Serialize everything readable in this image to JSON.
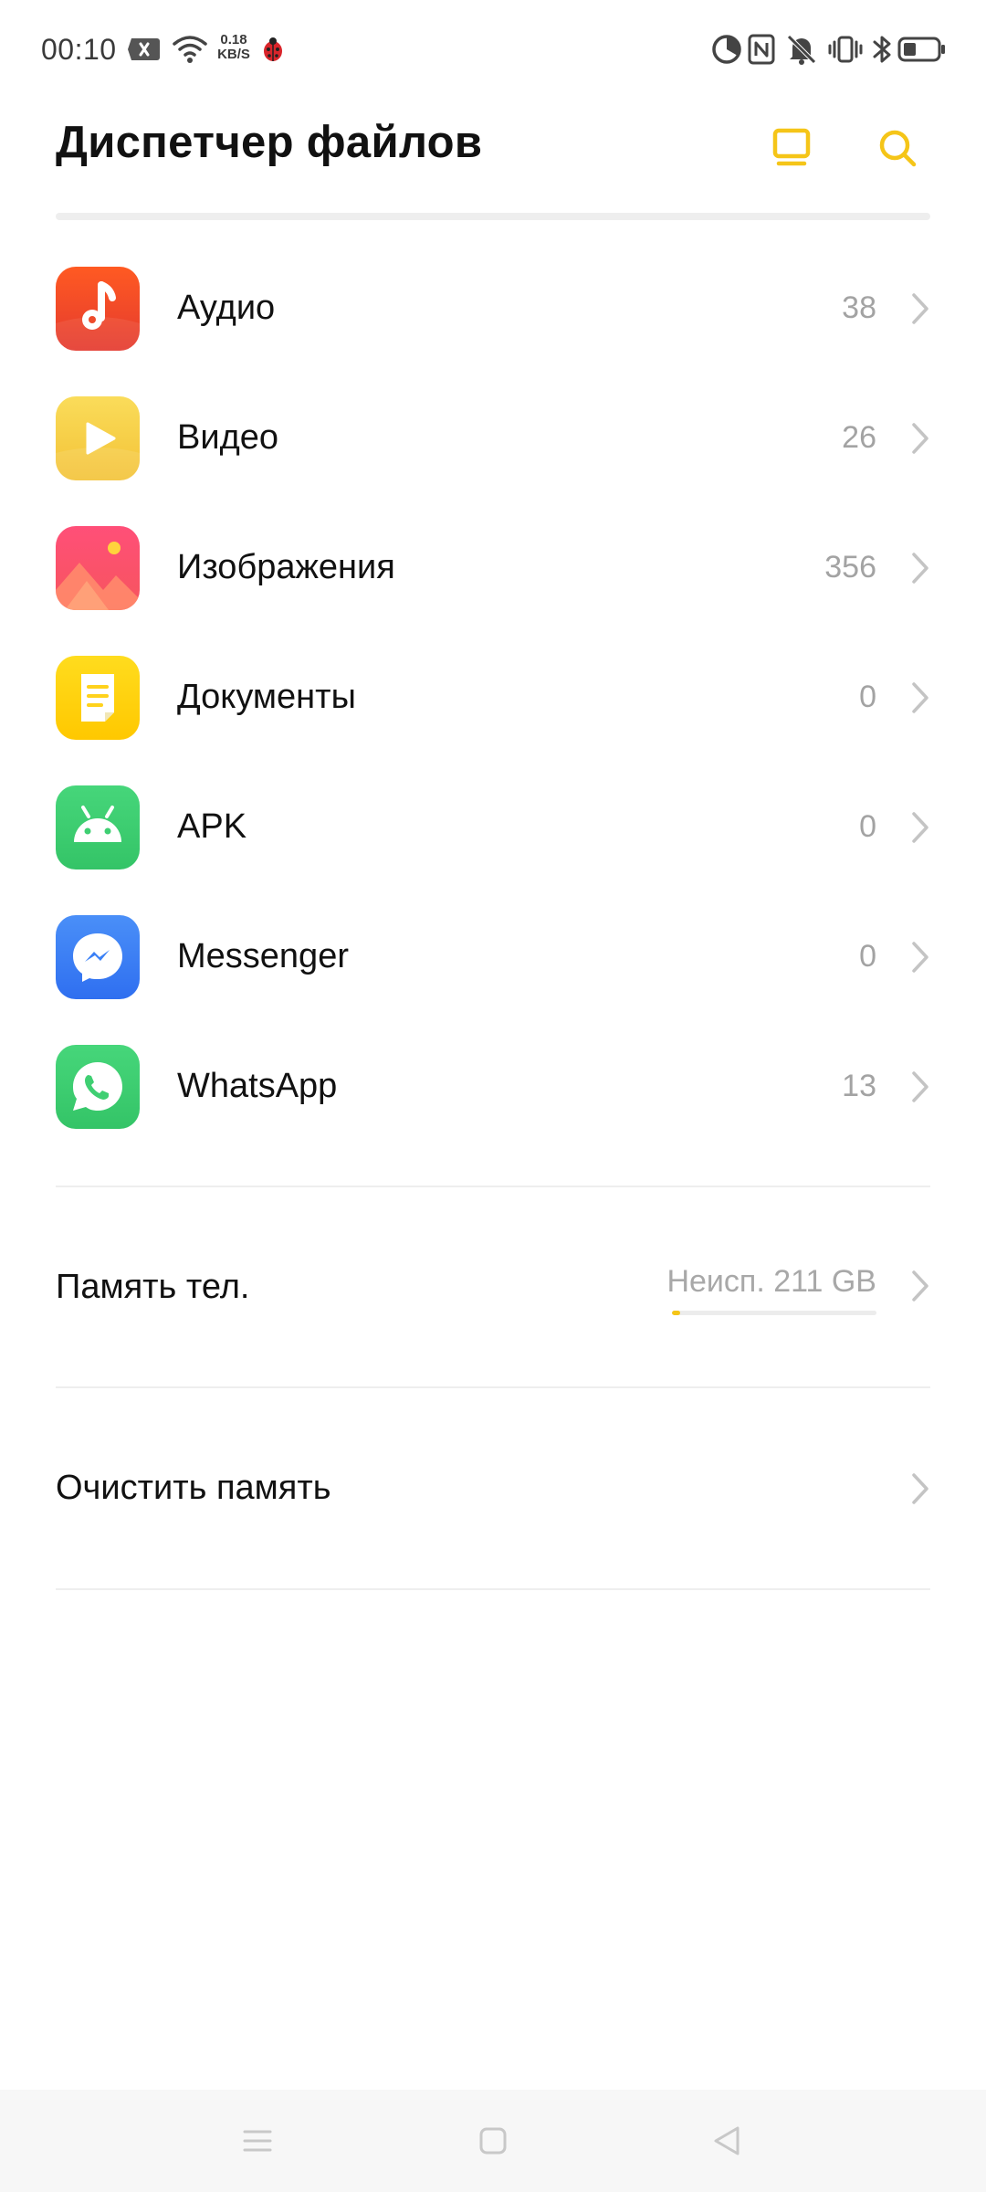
{
  "status_bar": {
    "time": "00:10",
    "net_speed_value": "0.18",
    "net_speed_unit": "KB/S",
    "icons": [
      "notification-x-icon",
      "wifi-icon",
      "ladybug-icon",
      "data-saver-icon",
      "nfc-icon",
      "mute-icon",
      "vibrate-icon",
      "bluetooth-icon",
      "battery-icon"
    ]
  },
  "header": {
    "title": "Диспетчер файлов",
    "icons": [
      "desktop-icon",
      "search-icon"
    ]
  },
  "categories": [
    {
      "label": "Аудио",
      "count": "38",
      "icon": "music-note-icon",
      "color": "#ee4b2b"
    },
    {
      "label": "Видео",
      "count": "26",
      "icon": "play-icon",
      "color": "#f5c842"
    },
    {
      "label": "Изображения",
      "count": "356",
      "icon": "image-icon",
      "color": "#f8506a"
    },
    {
      "label": "Документы",
      "count": "0",
      "icon": "document-icon",
      "color": "#ffd21c"
    },
    {
      "label": "APK",
      "count": "0",
      "icon": "android-icon",
      "color": "#3fcf72"
    },
    {
      "label": "Messenger",
      "count": "0",
      "icon": "messenger-icon",
      "color": "#3a80f6"
    },
    {
      "label": "WhatsApp",
      "count": "13",
      "icon": "whatsapp-icon",
      "color": "#3fcf72"
    }
  ],
  "storage": {
    "label": "Память тел.",
    "free_text": "Неисп. 211 GB",
    "used_fraction": 0.04,
    "bar_color": "#f5c518"
  },
  "clean": {
    "label": "Очистить память"
  },
  "accent_color": "#f5c518",
  "nav_bar": {
    "icons": [
      "menu-icon",
      "home-icon",
      "back-icon"
    ]
  }
}
